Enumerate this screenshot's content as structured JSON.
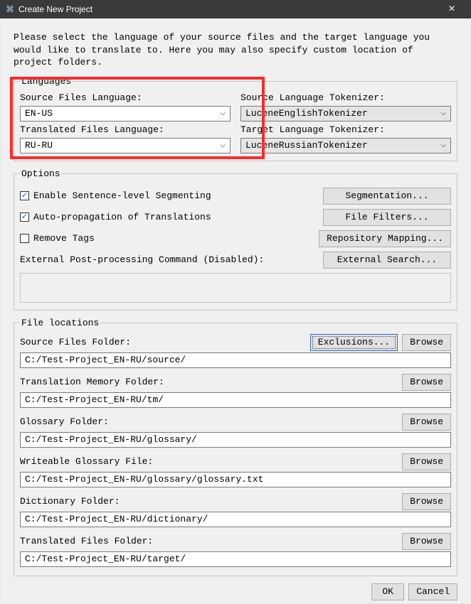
{
  "window": {
    "title": "Create New Project",
    "close": "×"
  },
  "intro": "Please select the language of your source files and the target language you would like to translate to. Here you may also specify custom location of project folders.",
  "languages": {
    "legend": "Languages",
    "source_label": "Source Files Language:",
    "source_value": "EN-US",
    "target_label": "Translated Files Language:",
    "target_value": "RU-RU",
    "src_tok_label": "Source Language Tokenizer:",
    "src_tok_value": "LuceneEnglishTokenizer",
    "tgt_tok_label": "Target Language Tokenizer:",
    "tgt_tok_value": "LuceneRussianTokenizer"
  },
  "options": {
    "legend": "Options",
    "enable_seg": "Enable Sentence-level Segmenting",
    "segmentation_btn": "Segmentation...",
    "auto_prop": "Auto-propagation of Translations",
    "file_filters_btn": "File Filters...",
    "remove_tags": "Remove Tags",
    "repo_map_btn": "Repository Mapping...",
    "ext_proc_label": "External Post-processing Command (Disabled):",
    "ext_search_btn": "External Search..."
  },
  "locations": {
    "legend": "File locations",
    "source_label": "Source Files Folder:",
    "exclusions_btn": "Exclusions...",
    "browse_btn": "Browse",
    "source_path": "C:/Test-Project_EN-RU/source/",
    "tm_label": "Translation Memory Folder:",
    "tm_path": "C:/Test-Project_EN-RU/tm/",
    "glossary_label": "Glossary Folder:",
    "glossary_path": "C:/Test-Project_EN-RU/glossary/",
    "wglossary_label": "Writeable Glossary File:",
    "wglossary_path": "C:/Test-Project_EN-RU/glossary/glossary.txt",
    "dict_label": "Dictionary Folder:",
    "dict_path": "C:/Test-Project_EN-RU/dictionary/",
    "translated_label": "Translated Files Folder:",
    "translated_path": "C:/Test-Project_EN-RU/target/"
  },
  "footer": {
    "ok": "OK",
    "cancel": "Cancel"
  },
  "glyphs": {
    "chevron": "⌵",
    "check": "✓"
  }
}
